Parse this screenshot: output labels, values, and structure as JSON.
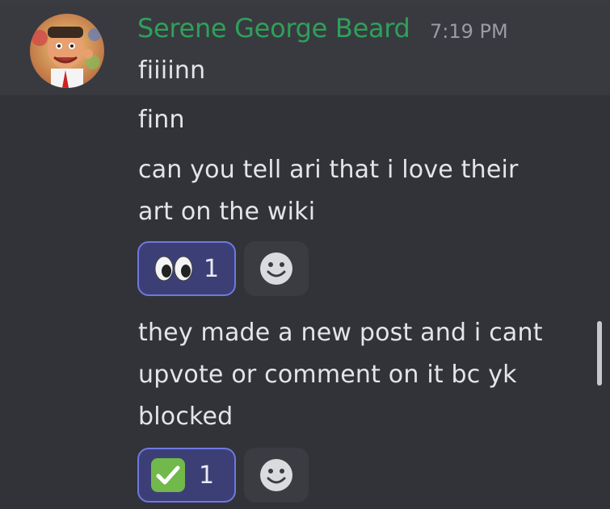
{
  "message": {
    "author": "Serene George Beard",
    "timestamp": "7:19 PM",
    "lines": [
      "fiiiinn",
      "finn",
      "can you tell ari that i love their",
      "art on the wiki",
      "they made a new post and i cant",
      "upvote or comment on it bc yk",
      "blocked"
    ]
  },
  "reactions": [
    {
      "emoji": "eyes-emoji",
      "count": "1"
    },
    {
      "emoji": "check-mark-emoji",
      "count": "1"
    }
  ],
  "colors": {
    "background": "#313338",
    "author": "#2ea05a",
    "reaction_border": "#6f78e0",
    "reaction_bg": "#3c3f75",
    "check_green": "#71b94a"
  }
}
